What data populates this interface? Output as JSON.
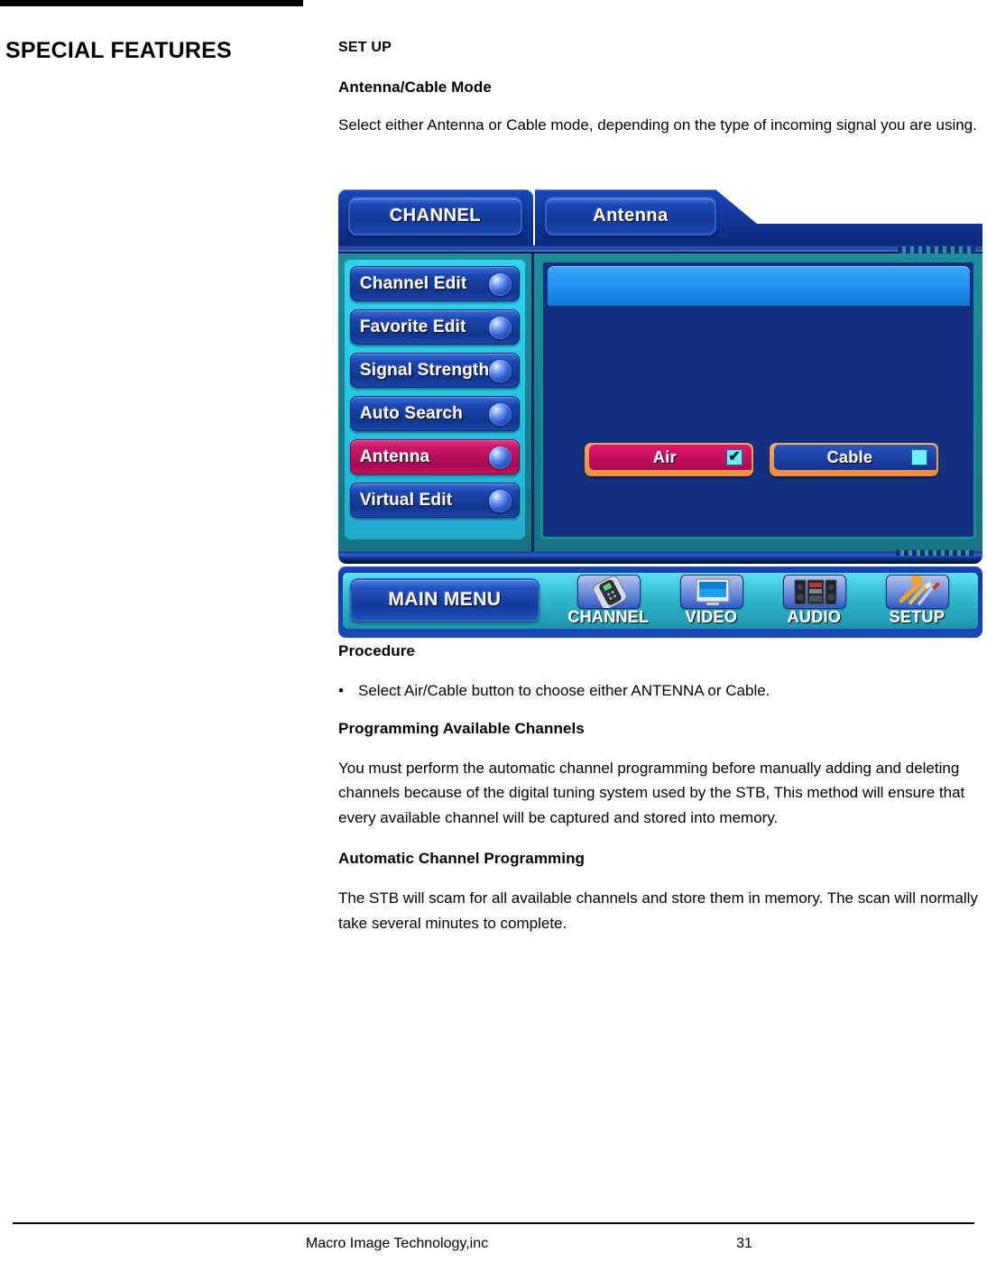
{
  "chapter": {
    "title": "SPECIAL FEATURES"
  },
  "content": {
    "section_heading": "SET UP",
    "sub_heading": "Antenna/Cable Mode",
    "intro_paragraph": "Select either Antenna or Cable mode, depending on the type of incoming signal you are using.",
    "procedure_heading": "Procedure",
    "procedure_bullet": "Select Air/Cable button to choose either ANTENNA or Cable.",
    "programming_heading": "Programming Available Channels",
    "programming_paragraph": "You must perform the automatic channel programming before manually adding and deleting channels because of the digital tuning system used by the STB, This method will ensure that every available channel will be captured and stored into memory.",
    "auto_heading": "Automatic Channel Programming",
    "auto_paragraph": "The STB will scam for all available channels and store them in memory. The scan will normally take several minutes to complete."
  },
  "osd": {
    "tabs": [
      {
        "label": "CHANNEL",
        "name": "tab-channel"
      },
      {
        "label": "Antenna",
        "name": "tab-antenna"
      }
    ],
    "menu_items": [
      {
        "label": "Channel Edit",
        "selected": false
      },
      {
        "label": "Favorite Edit",
        "selected": false
      },
      {
        "label": "Signal Strength",
        "selected": false
      },
      {
        "label": "Auto Search",
        "selected": false
      },
      {
        "label": "Antenna",
        "selected": true
      },
      {
        "label": "Virtual Edit",
        "selected": false
      }
    ],
    "options": [
      {
        "label": "Air",
        "checked": true,
        "check_glyph": "✔"
      },
      {
        "label": "Cable",
        "checked": false,
        "check_glyph": ""
      }
    ],
    "main_menu_label": "MAIN MENU",
    "nav_items": [
      {
        "label": "CHANNEL",
        "icon": "remote-control-icon"
      },
      {
        "label": "VIDEO",
        "icon": "television-icon"
      },
      {
        "label": "AUDIO",
        "icon": "stereo-system-icon"
      },
      {
        "label": "SETUP",
        "icon": "tools-icon"
      }
    ],
    "colors": {
      "selected_menu": "#c3145f",
      "option_on": "#c30e5f",
      "option_off": "#1a41a4",
      "option_border": "#ef8c3c",
      "checkbox": "#6ff0f8",
      "sidebar_panel": "#27c3e4",
      "panel_body": "#12307e",
      "chassis_blue": "#12369c",
      "teal_frame": "#1a8b97"
    }
  },
  "footer": {
    "company": "Macro Image Technology,inc",
    "page_number": "31"
  }
}
